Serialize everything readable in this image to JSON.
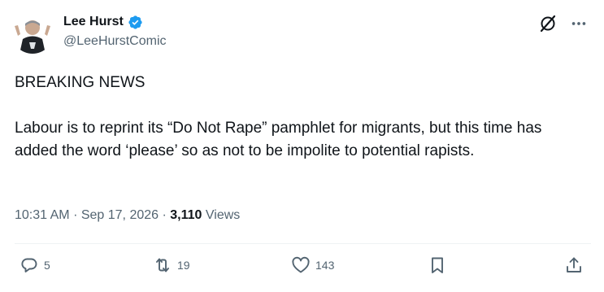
{
  "author": {
    "display_name": "Lee Hurst",
    "handle": "@LeeHurstComic",
    "verified": true
  },
  "header_icons": [
    "grok-icon",
    "more-icon"
  ],
  "tweet": {
    "headline": "BREAKING NEWS",
    "text": "Labour is to reprint its “Do Not Rape” pamphlet for migrants, but this time has added the word ‘please’ so as not to be impolite to potential rapists."
  },
  "meta": {
    "time": "10:31 AM",
    "date": "Sep 17, 2026",
    "separator": "·",
    "views_count": "3,110",
    "views_label": "Views"
  },
  "actions": {
    "replies": "5",
    "reposts": "19",
    "likes": "143"
  },
  "colors": {
    "text": "#0f1419",
    "secondary": "#536471",
    "verified": "#1d9bf0",
    "divider": "#eff3f4"
  }
}
